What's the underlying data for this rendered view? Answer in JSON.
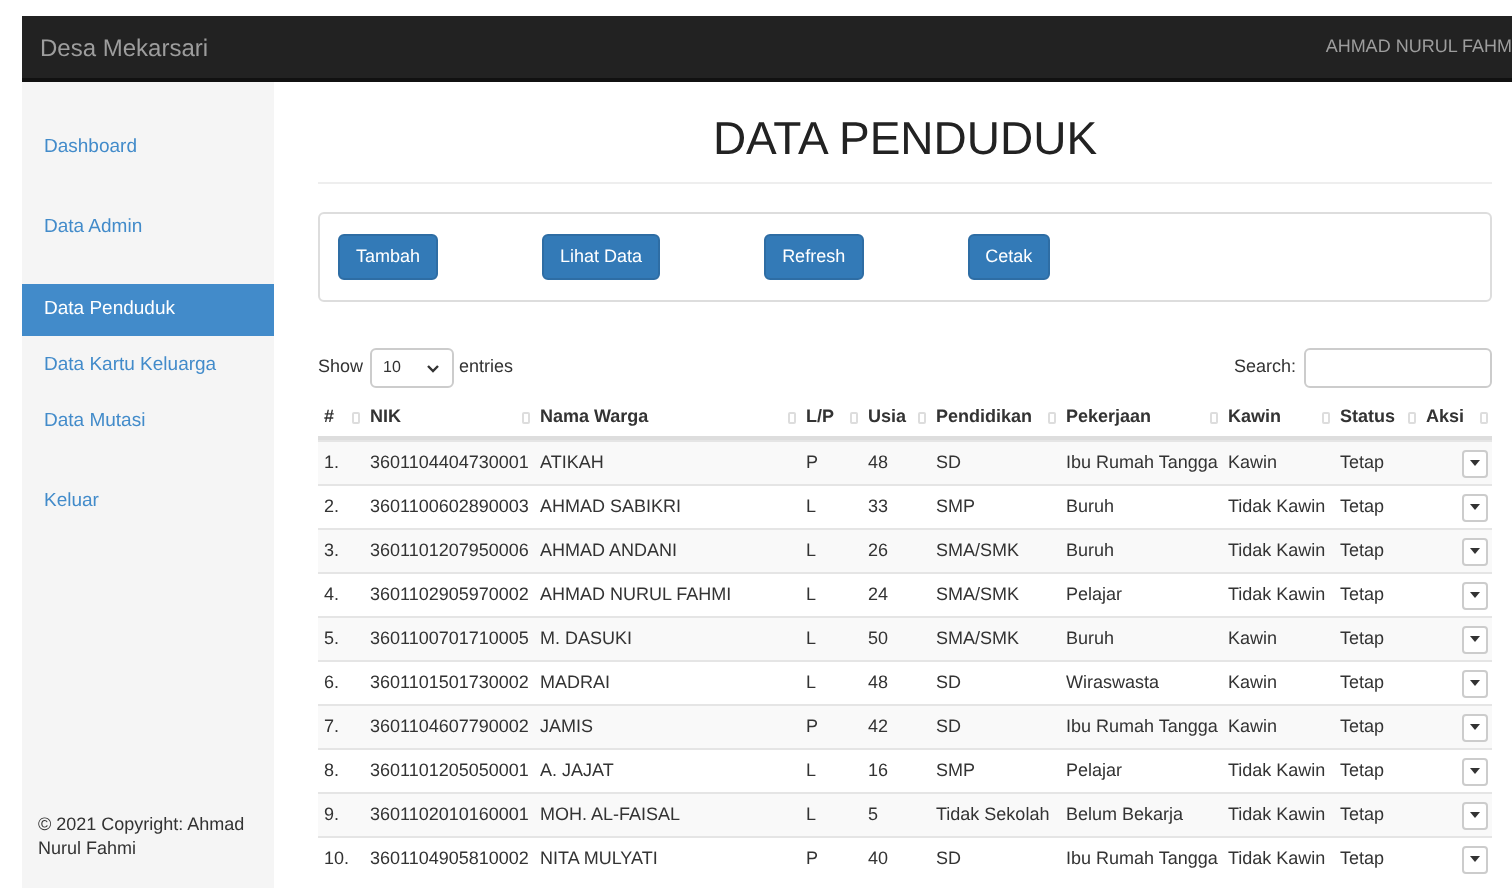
{
  "navbar": {
    "brand": "Desa Mekarsari",
    "user": "AHMAD NURUL FAHM"
  },
  "sidebar": {
    "items": [
      {
        "label": "Dashboard",
        "selected": false
      },
      {
        "label": "Data Admin",
        "selected": false
      },
      {
        "label": "Data Penduduk",
        "selected": true
      },
      {
        "label": "Data Kartu Keluarga",
        "selected": false
      },
      {
        "label": "Data Mutasi",
        "selected": false
      },
      {
        "label": "Keluar",
        "selected": false
      }
    ],
    "footer": "© 2021 Copyright: Ahmad Nurul Fahmi"
  },
  "page_title": "DATA PENDUDUK",
  "buttons": [
    "Tambah",
    "Lihat Data",
    "Refresh",
    "Cetak"
  ],
  "table_controls": {
    "show_label": "Show",
    "page_size": "10",
    "entries_label": "entries",
    "search_label": "Search:"
  },
  "table": {
    "columns": [
      "#",
      "NIK",
      "Nama Warga",
      "L/P",
      "Usia",
      "Pendidikan",
      "Pekerjaan",
      "Kawin",
      "Status",
      "Aksi"
    ],
    "rows": [
      [
        "1.",
        "3601104404730001",
        "ATIKAH",
        "P",
        "48",
        "SD",
        "Ibu Rumah Tangga",
        "Kawin",
        "Tetap"
      ],
      [
        "2.",
        "3601100602890003",
        "AHMAD SABIKRI",
        "L",
        "33",
        "SMP",
        "Buruh",
        "Tidak Kawin",
        "Tetap"
      ],
      [
        "3.",
        "3601101207950006",
        "AHMAD ANDANI",
        "L",
        "26",
        "SMA/SMK",
        "Buruh",
        "Tidak Kawin",
        "Tetap"
      ],
      [
        "4.",
        "3601102905970002",
        "AHMAD NURUL FAHMI",
        "L",
        "24",
        "SMA/SMK",
        "Pelajar",
        "Tidak Kawin",
        "Tetap"
      ],
      [
        "5.",
        "3601100701710005",
        "M. DASUKI",
        "L",
        "50",
        "SMA/SMK",
        "Buruh",
        "Kawin",
        "Tetap"
      ],
      [
        "6.",
        "3601101501730002",
        "MADRAI",
        "L",
        "48",
        "SD",
        "Wiraswasta",
        "Kawin",
        "Tetap"
      ],
      [
        "7.",
        "3601104607790002",
        "JAMIS",
        "P",
        "42",
        "SD",
        "Ibu Rumah Tangga",
        "Kawin",
        "Tetap"
      ],
      [
        "8.",
        "3601101205050001",
        "A. JAJAT",
        "L",
        "16",
        "SMP",
        "Pelajar",
        "Tidak Kawin",
        "Tetap"
      ],
      [
        "9.",
        "3601102010160001",
        "MOH. AL-FAISAL",
        "L",
        "5",
        "Tidak Sekolah",
        "Belum Bekarja",
        "Tidak Kawin",
        "Tetap"
      ],
      [
        "10.",
        "3601104905810002",
        "NITA MULYATI",
        "P",
        "40",
        "SD",
        "Ibu Rumah Tangga",
        "Tidak Kawin",
        "Tetap"
      ]
    ]
  }
}
